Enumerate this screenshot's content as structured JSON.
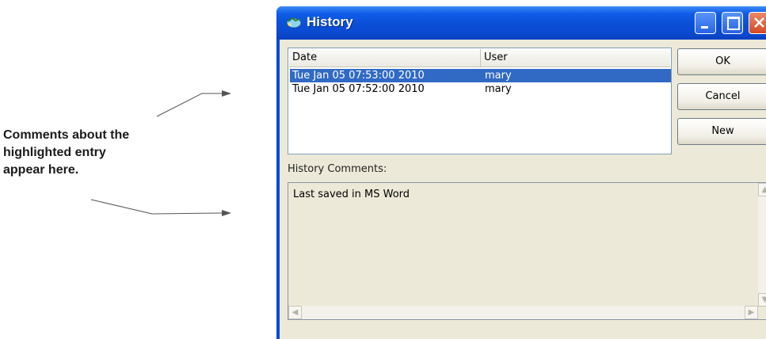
{
  "annotation": {
    "lines": [
      "Comments about the",
      "highlighted entry",
      "appear here."
    ]
  },
  "window": {
    "title": "History",
    "icon": "history-app-icon",
    "controls": {
      "minimize": "minimize-icon",
      "maximize": "maximize-icon",
      "close": "close-icon"
    }
  },
  "list": {
    "columns": [
      "Date",
      "User"
    ],
    "rows": [
      {
        "date": "Tue Jan 05 07:53:00 2010",
        "user": "mary",
        "selected": true
      },
      {
        "date": "Tue Jan 05 07:52:00 2010",
        "user": "mary",
        "selected": false
      }
    ]
  },
  "buttons": {
    "ok": "OK",
    "cancel": "Cancel",
    "new": "New"
  },
  "comments": {
    "label": "History Comments:",
    "text": "Last saved in MS Word"
  },
  "colors": {
    "titlebar": "#0a4fd6",
    "selection": "#316ac5",
    "dialog_bg": "#ece9d8"
  }
}
